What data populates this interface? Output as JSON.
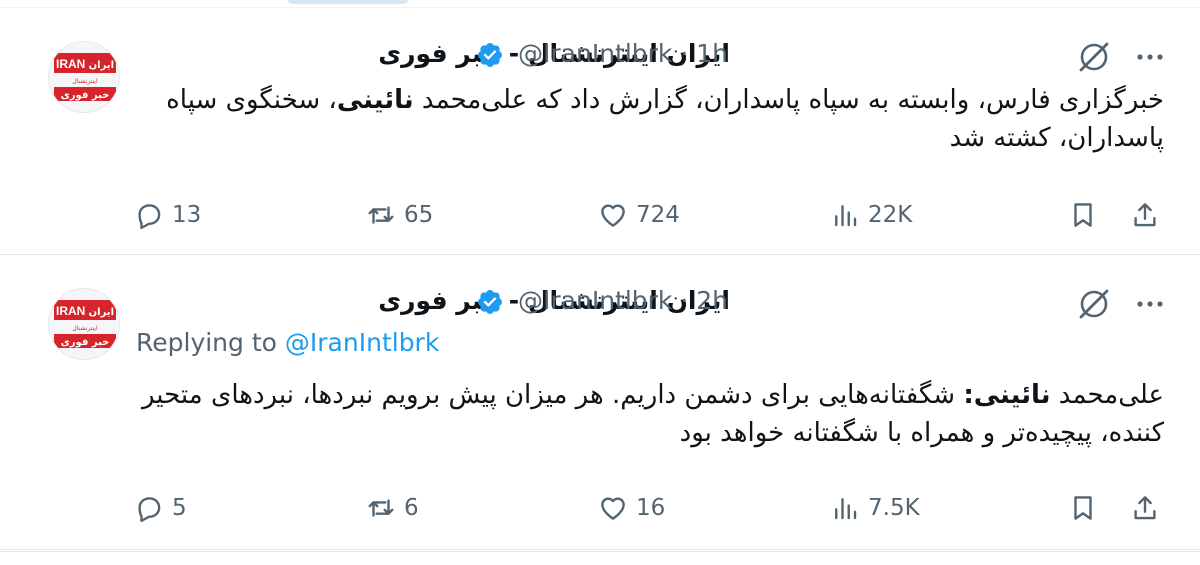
{
  "colors": {
    "accent": "#1d9bf0",
    "muted": "#536471",
    "text": "#0f1419",
    "logo_red": "#d6242a"
  },
  "icons": [
    "verified-badge-icon",
    "grok-icon",
    "more-icon",
    "reply-icon",
    "retweet-icon",
    "like-icon",
    "views-icon",
    "bookmark-icon",
    "share-icon"
  ],
  "tweets": [
    {
      "display_name": "ایران اینترنشنال - خبر فوری",
      "handle": "@IranIntlbrk",
      "separator": "·",
      "time": "1h",
      "body_before": "خبرگزاری فارس، وابسته به سپاه پاسداران، گزارش داد که علی‌محمد ",
      "body_bold": "نائینی",
      "body_after": "، سخنگوی سپاه پاسداران، کشته شد",
      "stats": {
        "replies": "13",
        "retweets": "65",
        "likes": "724",
        "views": "22K"
      }
    },
    {
      "display_name": "ایران اینترنشنال - خبر فوری",
      "handle": "@IranIntlbrk",
      "separator": "·",
      "time": "2h",
      "reply_prefix": "Replying to",
      "reply_to": "@IranIntlbrk",
      "body_before": "علی‌محمد ",
      "body_bold": "نائینی:",
      "body_after": " شگفتانه‌هایی برای دشمن داریم. هر میزان پیش برویم نبردها، نبردهای متحیر کننده، پیچیده‌تر و همراه با شگفتانه خواهد بود",
      "stats": {
        "replies": "5",
        "retweets": "6",
        "likes": "16",
        "views": "7.5K"
      }
    }
  ],
  "avatar": {
    "logo_top": "IRAN",
    "logo_top_fa": "ایران",
    "logo_mid": "اینترنشنال",
    "logo_bottom": "خبر فوری"
  }
}
